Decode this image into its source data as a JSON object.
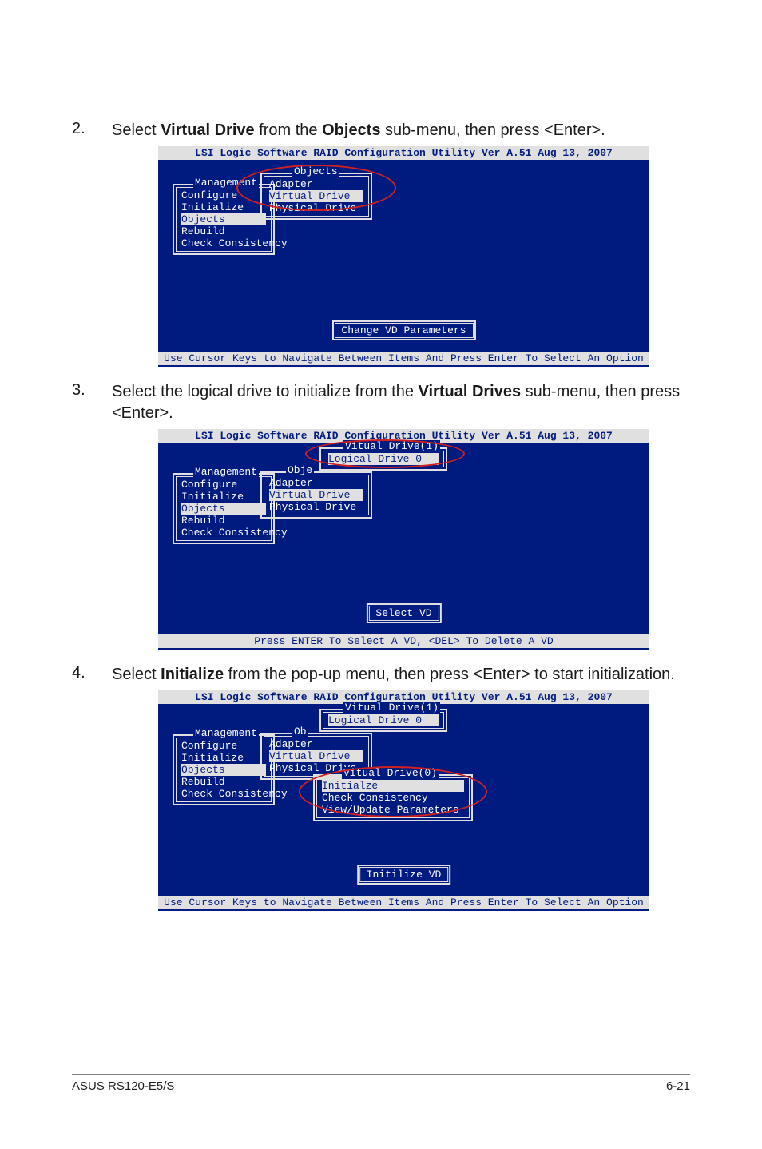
{
  "steps": {
    "s2": {
      "num": "2.",
      "text_pre": "Select ",
      "b1": "Virtual Drive",
      "mid1": " from the ",
      "b2": "Objects",
      "post": " sub-menu, then press <Enter>."
    },
    "s3": {
      "num": "3.",
      "text_pre": "Select the logical drive to initialize from the ",
      "b1": "Virtual Drives",
      "post": " sub-menu, then press <Enter>."
    },
    "s4": {
      "num": "4.",
      "text_pre": "Select ",
      "b1": "Initialize",
      "post": " from the pop-up menu, then press <Enter> to start initialization."
    }
  },
  "bios_title": "LSI Logic Software RAID Configuration Utility Ver A.51 Aug 13, 2007",
  "management": {
    "label": "Management",
    "items": [
      "Configure",
      "Initialize",
      "Objects",
      "Rebuild",
      "Check Consistency"
    ],
    "hl_index": 2
  },
  "objects": {
    "label_full": "Objects",
    "label_short": "Obje",
    "label_ob": "Ob",
    "items": [
      "Adapter",
      "Virtual Drive",
      "Physical Drive"
    ],
    "hl_index": 1
  },
  "vd1": {
    "title": "Vitual Drive(1)",
    "item": "Logical Drive 0"
  },
  "vd0": {
    "title": "Vitual Drive(0)",
    "items": [
      "Initialze",
      "Check Consistency",
      "View/Update Parameters"
    ],
    "hl_index": 0
  },
  "status": {
    "s2": "Change VD Parameters",
    "s3": "Select VD",
    "s4": "Initilize VD"
  },
  "footers": {
    "nav": "Use Cursor Keys to Navigate Between Items And Press Enter To Select An Option",
    "vd_sel": "Press ENTER To Select A VD, <DEL> To Delete A VD"
  },
  "page_footer": {
    "left": "ASUS RS120-E5/S",
    "right": "6-21"
  }
}
